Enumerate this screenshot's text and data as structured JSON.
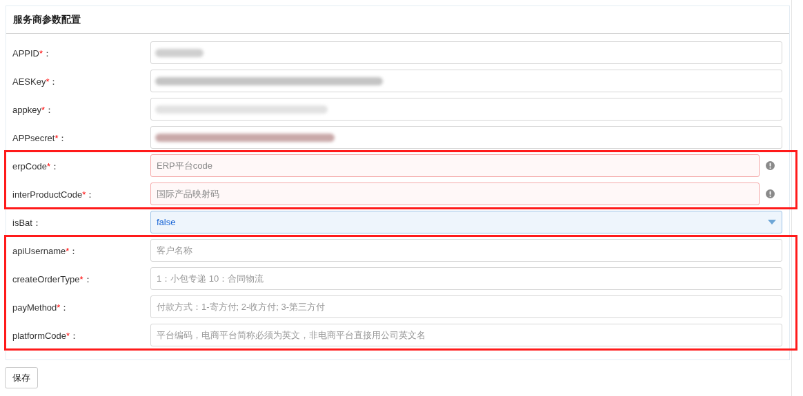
{
  "panel": {
    "title": "服务商参数配置"
  },
  "groups": [
    {
      "boxed": false,
      "rows": [
        {
          "label": "APPID",
          "required_mark": "*",
          "colon": "：",
          "kind": "redacted"
        },
        {
          "label": "AESKey",
          "required_mark": "*",
          "colon": "：",
          "kind": "redacted"
        },
        {
          "label": "appkey",
          "required_mark": "*",
          "colon": "：",
          "kind": "redacted"
        },
        {
          "label": "APPsecret",
          "required_mark": "*",
          "colon": "：",
          "kind": "redacted"
        }
      ]
    },
    {
      "boxed": true,
      "rows": [
        {
          "label": "erpCode",
          "required_mark": "*",
          "colon": "：",
          "kind": "text",
          "placeholder": "ERP平台code",
          "invalid": true
        },
        {
          "label": "interProductCode",
          "required_mark": "*",
          "colon": "：",
          "kind": "text",
          "placeholder": "国际产品映射码",
          "invalid": true
        }
      ]
    },
    {
      "boxed": false,
      "rows": [
        {
          "label": "isBat",
          "colon": "：",
          "kind": "select",
          "value": "false"
        }
      ]
    },
    {
      "boxed": true,
      "rows": [
        {
          "label": "apiUsername",
          "required_mark": "*",
          "colon": "：",
          "kind": "text",
          "placeholder": "客户名称",
          "invalid": false
        },
        {
          "label": "createOrderType",
          "required_mark": "*",
          "colon": "：",
          "kind": "text",
          "placeholder": "1：小包专递 10：合同物流",
          "invalid": false
        },
        {
          "label": "payMethod",
          "required_mark": "*",
          "colon": "：",
          "kind": "text",
          "placeholder": "付款方式：1-寄方付; 2-收方付; 3-第三方付",
          "invalid": false
        },
        {
          "label": "platformCode",
          "required_mark": "*",
          "colon": "：",
          "kind": "text",
          "placeholder": "平台编码，电商平台简称必须为英文，非电商平台直接用公司英文名",
          "invalid": false
        }
      ]
    }
  ],
  "save_button": "保存"
}
